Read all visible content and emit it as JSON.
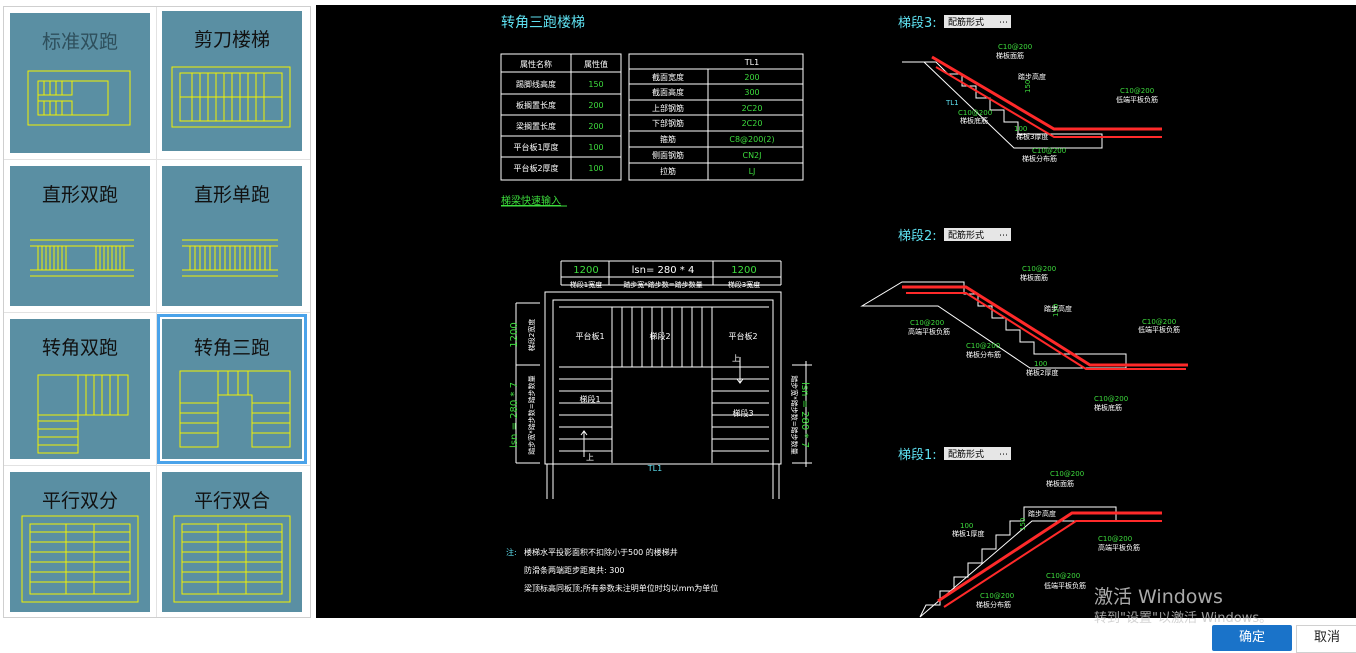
{
  "gallery": {
    "items": [
      {
        "label": "标准双跑"
      },
      {
        "label": "剪刀楼梯"
      },
      {
        "label": "直形双跑"
      },
      {
        "label": "直形单跑"
      },
      {
        "label": "转角双跑"
      },
      {
        "label": "转角三跑"
      },
      {
        "label": "平行双分"
      },
      {
        "label": "平行双合"
      }
    ],
    "selected_index": 5
  },
  "drawing": {
    "title": "转角三跑楼梯",
    "params_table": {
      "headers": [
        "属性名称",
        "属性值"
      ],
      "rows": [
        [
          "踢脚线高度",
          "150"
        ],
        [
          "板搁置长度",
          "200"
        ],
        [
          "梁搁置长度",
          "200"
        ],
        [
          "平台板1厚度",
          "100"
        ],
        [
          "平台板2厚度",
          "100"
        ]
      ]
    },
    "beam_table": {
      "title": "TL1",
      "rows": [
        [
          "截面宽度",
          "200"
        ],
        [
          "截面高度",
          "300"
        ],
        [
          "上部钢筋",
          "2C20"
        ],
        [
          "下部钢筋",
          "2C20"
        ],
        [
          "箍筋",
          "C8@200(2)"
        ],
        [
          "侧面钢筋",
          "CN2J"
        ],
        [
          "拉筋",
          "LJ"
        ]
      ]
    },
    "quick_input_link": "梯梁快速输入",
    "plan": {
      "dim_top": [
        "1200",
        "lsn= 280 * 4",
        "1200"
      ],
      "dim_top_sub": [
        "梯段1宽度",
        "踏步宽*踏步数=踏步数量",
        "梯段3宽度"
      ],
      "dim_left": [
        "1200",
        "lsn = 280 * 7"
      ],
      "dim_left_sub": [
        "梯段2宽度",
        "踏步宽*踏步数=踏步数量"
      ],
      "dim_right": [
        "lsn = 280 * 7"
      ],
      "dim_right_sub": [
        "踏步宽*踏步数=踏步数量"
      ],
      "labels": [
        "平台板1",
        "梯段2",
        "平台板2",
        "梯段1",
        "梯段3",
        "TL1",
        "上",
        "上"
      ]
    },
    "notes": {
      "prefix": "注:",
      "lines": [
        "楼梯水平投影面积不扣除小于500 的楼梯井",
        "防滑条两端距步距离共: 300",
        "梁顶标高同板顶;所有参数未注明单位时均以mm为单位"
      ]
    },
    "segments": [
      {
        "title": "梯段3:",
        "select": "配筋形式",
        "labels": [
          "C10@200",
          "梯板面筋",
          "踏步高度",
          "150",
          "TL1",
          "C10@200",
          "梯板底筋",
          "100",
          "梯板3厚度",
          "C10@200",
          "梯板分布筋",
          "C10@200",
          "低端平板负筋"
        ]
      },
      {
        "title": "梯段2:",
        "select": "配筋形式",
        "labels": [
          "C10@200",
          "梯板面筋",
          "踏步高度",
          "150",
          "C10@200",
          "高端平板负筋",
          "C10@200",
          "梯板分布筋",
          "100",
          "梯板2厚度",
          "C10@200",
          "低端平板负筋",
          "C10@200",
          "梯板底筋"
        ]
      },
      {
        "title": "梯段1:",
        "select": "配筋形式",
        "labels": [
          "C10@200",
          "梯板面筋",
          "踏步高度",
          "150",
          "100",
          "梯板1厚度",
          "C10@200",
          "高端平板负筋",
          "C10@200",
          "低端平板负筋",
          "C10@200",
          "梯板分布筋"
        ]
      }
    ]
  },
  "watermark": {
    "line1": "激活 Windows",
    "line2": "转到\"设置\"以激活 Windows。"
  },
  "buttons": {
    "ok": "确定",
    "cancel": "取消"
  },
  "colors": {
    "cad_bg": "#000000",
    "tile_bg": "#5a8fa3",
    "cad_line": "#ffffff",
    "cad_accent": "#5ee0f0",
    "cad_value": "#3ddc3d",
    "rebar": "#ff2a2a",
    "ok_button": "#1a73c9"
  }
}
